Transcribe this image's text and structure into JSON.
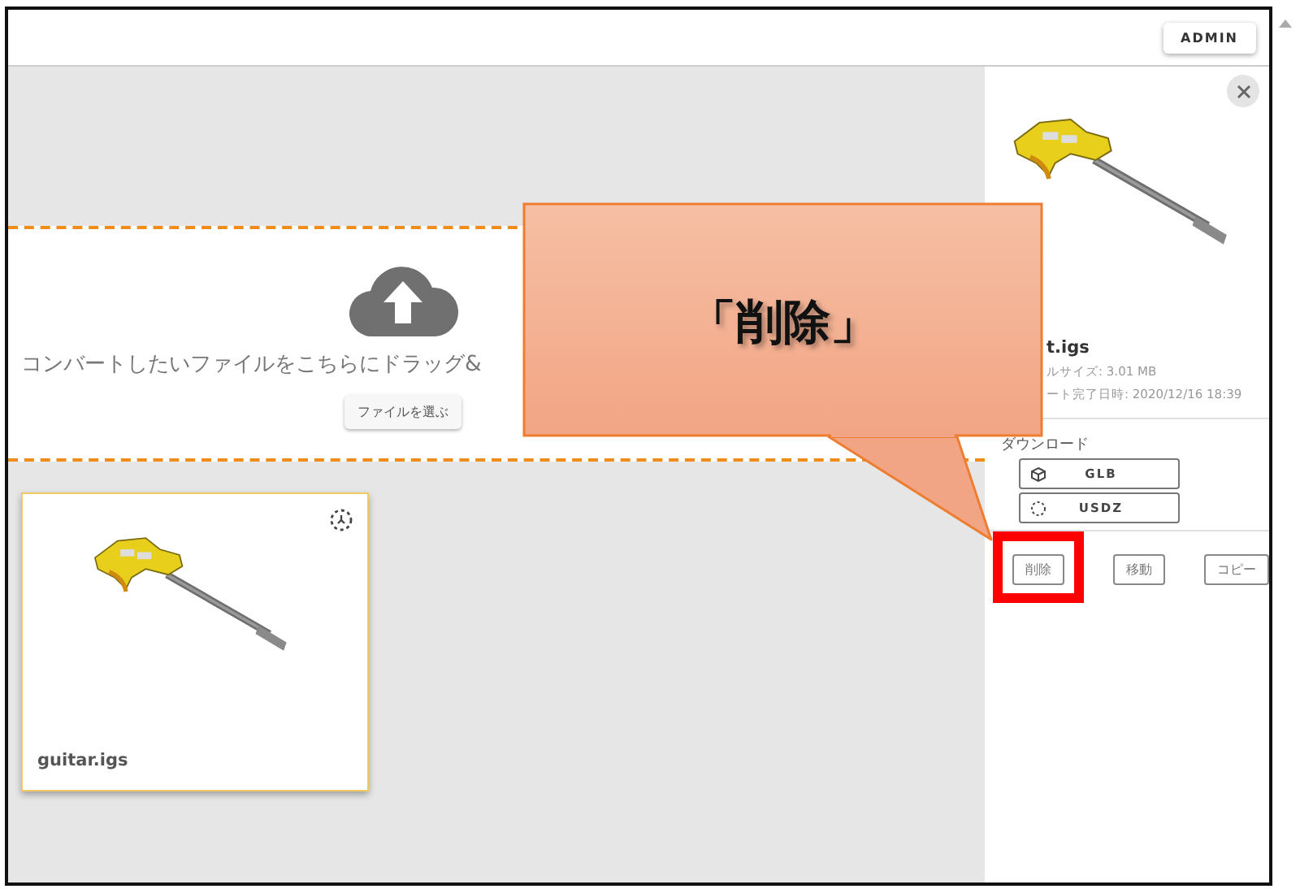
{
  "header": {
    "admin_button": "ADMIN"
  },
  "drop_zone": {
    "message": "コンバートしたいファイルをこちらにドラッグ&",
    "button": "ファイルを選ぶ"
  },
  "files": [
    {
      "name": "guitar.igs",
      "selected": true
    }
  ],
  "detail": {
    "file_name": "t.igs",
    "size": "ルサイズ: 3.01 MB",
    "converted": "ート完了日時: 2020/12/16 18:39",
    "download_label": "ダウンロード",
    "downloads": [
      {
        "label": "GLB",
        "kind": "cube"
      },
      {
        "label": "USDZ",
        "kind": "ar"
      }
    ],
    "actions": [
      {
        "label": "削除",
        "highlighted": true
      },
      {
        "label": "移動",
        "highlighted": false
      },
      {
        "label": "コピー",
        "highlighted": false
      }
    ]
  },
  "callout": {
    "text": "「削除」"
  }
}
